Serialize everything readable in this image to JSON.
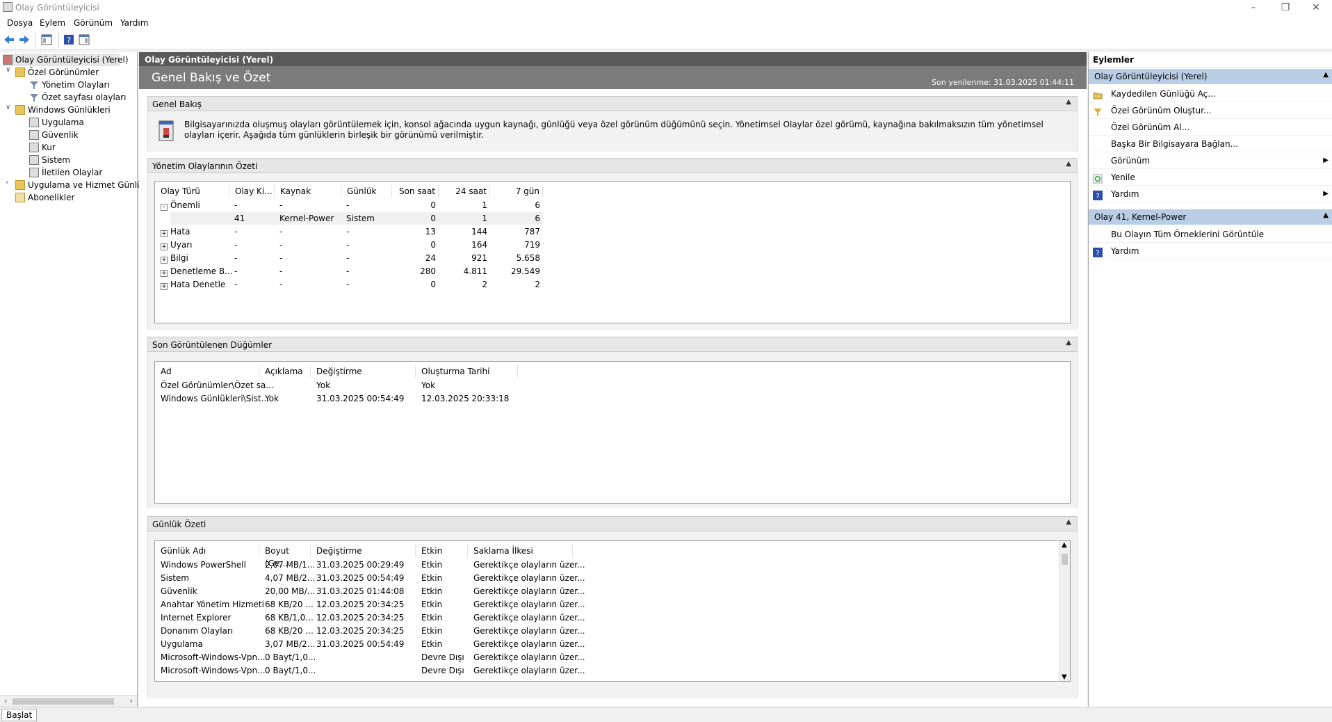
{
  "window": {
    "title": "Olay Görüntüleyicisi"
  },
  "menu": [
    "Dosya",
    "Eylem",
    "Görünüm",
    "Yardım"
  ],
  "tree": {
    "root": "Olay Görüntüleyicisi (Yerel)",
    "custom_views": "Özel Görünümler",
    "admin_events": "Yönetim Olayları",
    "summary_events": "Özet sayfası olayları",
    "windows_logs": "Windows Günlükleri",
    "app": "Uygulama",
    "security": "Güvenlik",
    "setup": "Kur",
    "system": "Sistem",
    "forwarded": "İletilen Olaylar",
    "app_services": "Uygulama ve Hizmet Günlük",
    "subscriptions": "Abonelikler"
  },
  "center": {
    "header": "Olay Görüntüleyicisi (Yerel)",
    "title": "Genel Bakış ve Özet",
    "last_refresh": "Son yenilenme: 31.03.2025 01:44:11",
    "overview": {
      "title": "Genel Bakış",
      "text": "Bilgisayarınızda oluşmuş olayları görüntülemek için, konsol ağacında uygun kaynağı, günlüğü veya özel görünüm düğümünü seçin. Yönetimsel Olaylar özel görümü, kaynağına bakılmaksızın tüm yönetimsel olayları içerir. Aşağıda tüm günlüklerin birleşik bir görünümü verilmiştir."
    },
    "admin_summary": {
      "title": "Yönetim Olaylarının Özeti",
      "columns": [
        "Olay Türü",
        "Olay Ki...",
        "Kaynak",
        "Günlük",
        "Son saat",
        "24 saat",
        "7 gün"
      ],
      "rows": [
        [
          "Önemli",
          "-",
          "-",
          "-",
          "0",
          "1",
          "6"
        ],
        [
          "",
          "41",
          "Kernel-Power",
          "Sistem",
          "0",
          "1",
          "6"
        ],
        [
          "Hata",
          "-",
          "-",
          "-",
          "13",
          "144",
          "787"
        ],
        [
          "Uyarı",
          "-",
          "-",
          "-",
          "0",
          "164",
          "719"
        ],
        [
          "Bilgi",
          "-",
          "-",
          "-",
          "24",
          "921",
          "5.658"
        ],
        [
          "Denetleme B...",
          "-",
          "-",
          "-",
          "280",
          "4.811",
          "29.549"
        ],
        [
          "Hata Denetle",
          "-",
          "-",
          "-",
          "0",
          "2",
          "2"
        ]
      ]
    },
    "recent": {
      "title": "Son Görüntülenen Düğümler",
      "columns": [
        "Ad",
        "Açıklama",
        "Değiştirme",
        "Oluşturma Tarihi"
      ],
      "rows": [
        [
          "Özel Görünümler\\Özet sa...",
          "",
          "Yok",
          "Yok"
        ],
        [
          "Windows Günlükleri\\Sist...",
          "Yok",
          "31.03.2025 00:54:49",
          "12.03.2025 20:33:18"
        ]
      ]
    },
    "log_summary": {
      "title": "Günlük Özeti",
      "columns": [
        "Günlük Adı",
        "Boyut (Ge...",
        "Değiştirme",
        "Etkin",
        "Saklama İlkesi"
      ],
      "rows": [
        [
          "Windows PowerShell",
          "2,07 MB/1...",
          "31.03.2025 00:29:49",
          "Etkin",
          "Gerektikçe olayların üzer..."
        ],
        [
          "Sistem",
          "4,07 MB/2...",
          "31.03.2025 00:54:49",
          "Etkin",
          "Gerektikçe olayların üzer..."
        ],
        [
          "Güvenlik",
          "20,00 MB/...",
          "31.03.2025 01:44:08",
          "Etkin",
          "Gerektikçe olayların üzer..."
        ],
        [
          "Anahtar Yönetim Hizmeti",
          "68 KB/20 ...",
          "12.03.2025 20:34:25",
          "Etkin",
          "Gerektikçe olayların üzer..."
        ],
        [
          "Internet Explorer",
          "68 KB/1,0...",
          "12.03.2025 20:34:25",
          "Etkin",
          "Gerektikçe olayların üzer..."
        ],
        [
          "Donanım Olayları",
          "68 KB/20 ...",
          "12.03.2025 20:34:25",
          "Etkin",
          "Gerektikçe olayların üzer..."
        ],
        [
          "Uygulama",
          "3,07 MB/2...",
          "31.03.2025 00:54:49",
          "Etkin",
          "Gerektikçe olayların üzer..."
        ],
        [
          "Microsoft-Windows-Vpn...",
          "0 Bayt/1,0...",
          "",
          "Devre Dışı",
          "Gerektikçe olayların üzer..."
        ],
        [
          "Microsoft-Windows-Vpn...",
          "0 Bayt/1,0...",
          "",
          "Devre Dışı",
          "Gerektikçe olayların üzer..."
        ]
      ]
    }
  },
  "actions": {
    "title": "Eylemler",
    "group1": "Olay Görüntüleyicisi (Yerel)",
    "items1": [
      "Kaydedilen Günlüğü Aç...",
      "Özel Görünüm Oluştur...",
      "Özel Görünüm Al...",
      "Başka Bir Bilgisayara Bağlan...",
      "Görünüm",
      "Yenile",
      "Yardım"
    ],
    "group2": "Olay 41, Kernel-Power",
    "items2": [
      "Bu Olayın Tüm Örneklerini Görüntüle",
      "Yardım"
    ]
  },
  "status": {
    "pane": "Başlat"
  },
  "colors": {
    "header_dark": "#595959",
    "header_mid": "#7b7b7b",
    "action_group": "#b9cde5"
  }
}
